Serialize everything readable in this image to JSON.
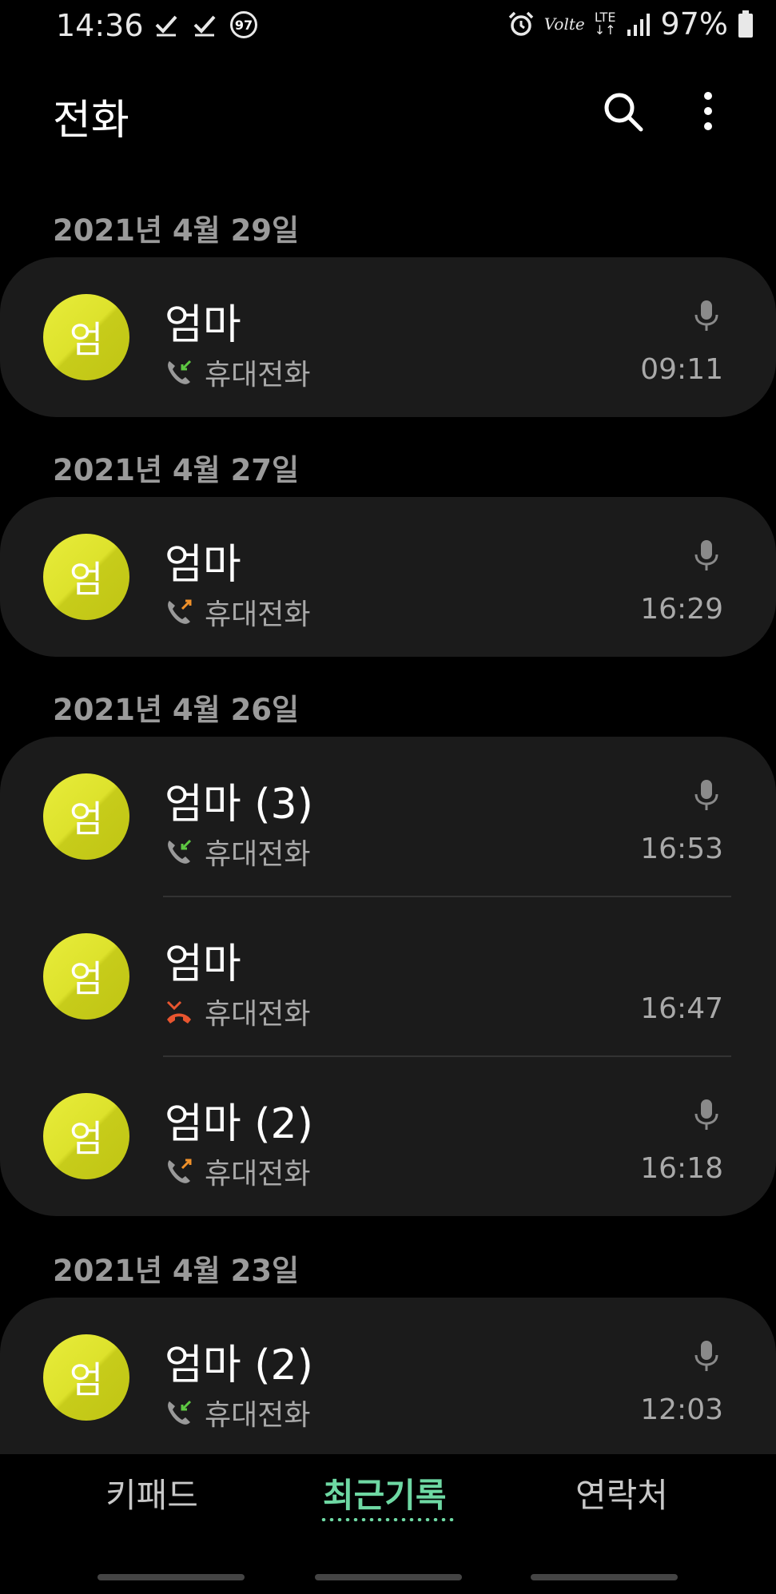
{
  "status_bar": {
    "time": "14:36",
    "notification_badge": "97",
    "network": "LTE",
    "volte": "Volte",
    "battery": "97%"
  },
  "header": {
    "title": "전화"
  },
  "groups": [
    {
      "date": "2021년 4월 29일",
      "calls": [
        {
          "avatar": "엄",
          "name": "엄마",
          "type": "휴대전화",
          "time": "09:11",
          "direction": "incoming",
          "recorded": true
        }
      ]
    },
    {
      "date": "2021년 4월 27일",
      "calls": [
        {
          "avatar": "엄",
          "name": "엄마",
          "type": "휴대전화",
          "time": "16:29",
          "direction": "outgoing",
          "recorded": true
        }
      ]
    },
    {
      "date": "2021년 4월 26일",
      "calls": [
        {
          "avatar": "엄",
          "name": "엄마 (3)",
          "type": "휴대전화",
          "time": "16:53",
          "direction": "incoming",
          "recorded": true
        },
        {
          "avatar": "엄",
          "name": "엄마",
          "type": "휴대전화",
          "time": "16:47",
          "direction": "missed",
          "recorded": false
        },
        {
          "avatar": "엄",
          "name": "엄마 (2)",
          "type": "휴대전화",
          "time": "16:18",
          "direction": "outgoing",
          "recorded": true
        }
      ]
    },
    {
      "date": "2021년 4월 23일",
      "calls": [
        {
          "avatar": "엄",
          "name": "엄마 (2)",
          "type": "휴대전화",
          "time": "12:03",
          "direction": "incoming",
          "recorded": true
        }
      ]
    }
  ],
  "nav": {
    "tabs": [
      {
        "label": "키패드",
        "active": false
      },
      {
        "label": "최근기록",
        "active": true
      },
      {
        "label": "연락처",
        "active": false
      }
    ]
  },
  "colors": {
    "background": "#000000",
    "card": "#1b1b1b",
    "avatar": "#dde22c",
    "accent": "#6ed8a3",
    "incoming_arrow": "#5ec842",
    "outgoing_arrow": "#f0912a",
    "missed": "#e8552f"
  }
}
